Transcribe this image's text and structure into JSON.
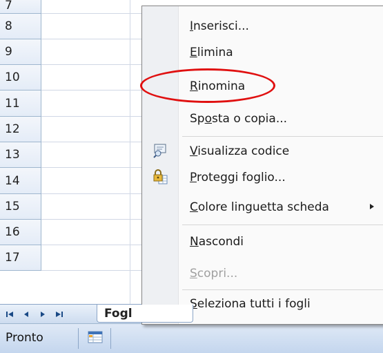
{
  "grid": {
    "row_numbers": [
      "7",
      "8",
      "9",
      "10",
      "11",
      "12",
      "13",
      "14",
      "15",
      "16",
      "17"
    ]
  },
  "sheet_nav": {
    "first_icon": "first-sheet-icon",
    "prev_icon": "prev-sheet-icon",
    "next_icon": "next-sheet-icon",
    "last_icon": "last-sheet-icon"
  },
  "sheet_tabs": [
    {
      "label": "Fogl",
      "active": true
    },
    {
      "label": "",
      "active": false
    },
    {
      "label": "",
      "active": false
    }
  ],
  "status_bar": {
    "status": "Pronto",
    "macro_icon": "record-macro-icon"
  },
  "context_menu": {
    "items": [
      {
        "pre": "",
        "key": "I",
        "post": "nserisci...",
        "icon": null,
        "enabled": true
      },
      {
        "pre": "",
        "key": "E",
        "post": "limina",
        "icon": null,
        "enabled": true
      },
      {
        "pre": "",
        "key": "R",
        "post": "inomina",
        "icon": null,
        "enabled": true
      },
      {
        "pre": "Sp",
        "key": "o",
        "post": "sta o copia...",
        "icon": null,
        "enabled": true
      },
      {
        "pre": "",
        "key": "V",
        "post": "isualizza codice",
        "icon": "view-code-icon",
        "enabled": true
      },
      {
        "pre": "",
        "key": "P",
        "post": "roteggi foglio...",
        "icon": "protect-sheet-icon",
        "enabled": true
      },
      {
        "pre": "",
        "key": "C",
        "post": "olore linguetta scheda",
        "icon": null,
        "enabled": true,
        "submenu": true
      },
      {
        "pre": "",
        "key": "N",
        "post": "ascondi",
        "icon": null,
        "enabled": true
      },
      {
        "pre": "",
        "key": "S",
        "post": "copri...",
        "icon": null,
        "enabled": false
      },
      {
        "pre": "",
        "key": "S",
        "post": "eleziona tutti i fogli",
        "icon": null,
        "enabled": true
      }
    ],
    "submenu_arrow_icon": "submenu-arrow-icon"
  },
  "annotation": {
    "color": "#e01010",
    "target": "Rinomina"
  }
}
